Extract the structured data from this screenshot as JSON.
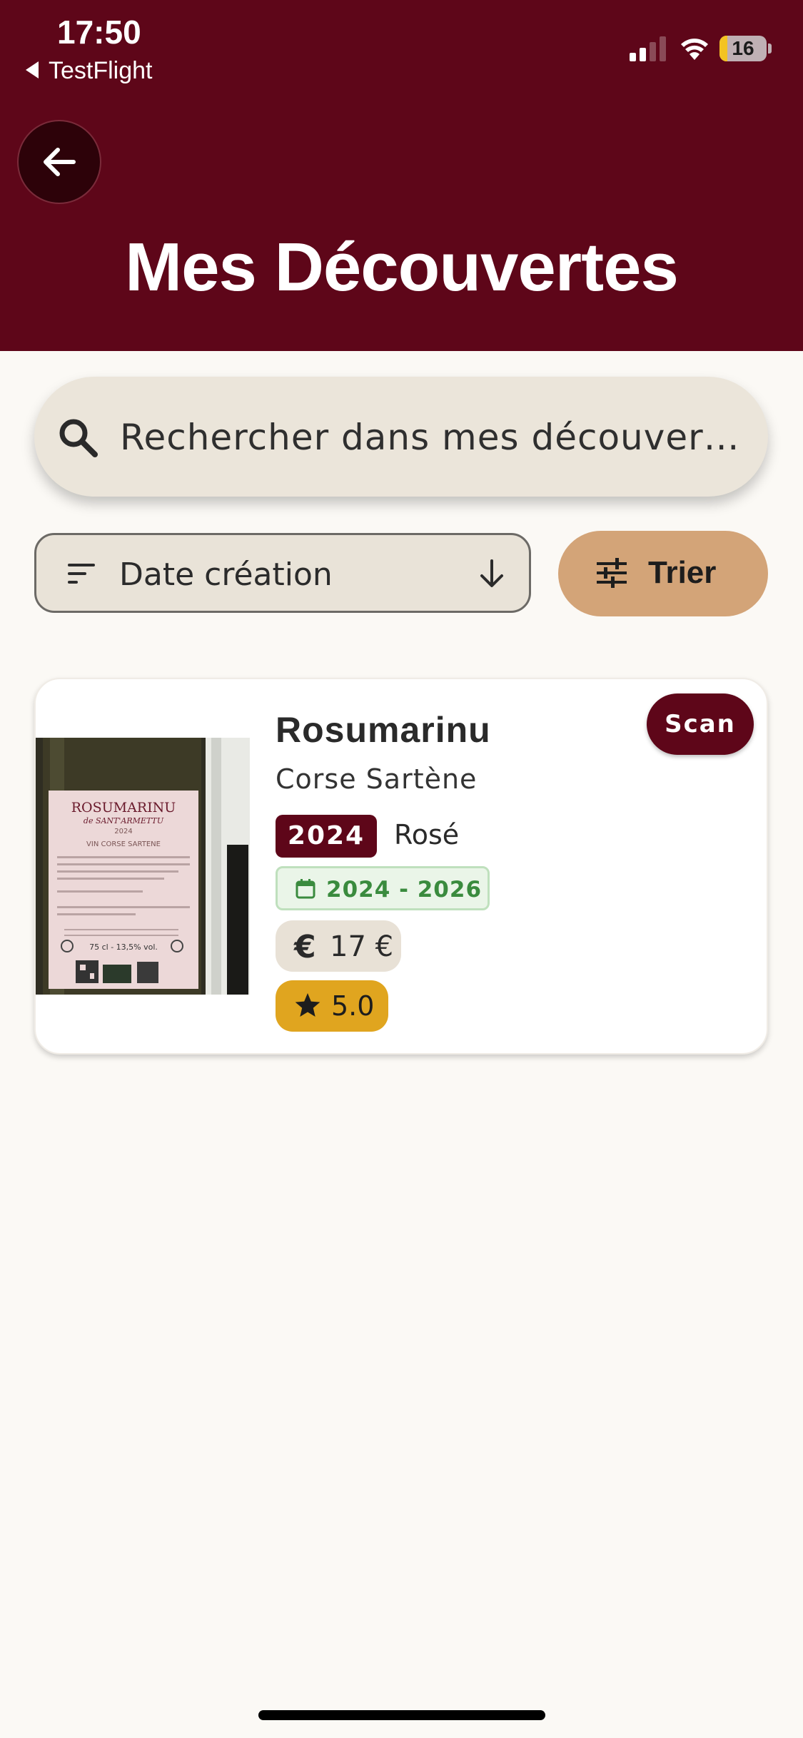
{
  "status_bar": {
    "time": "17:50",
    "back_app": "TestFlight",
    "battery_level": "16",
    "battery_fraction": 0.16
  },
  "header": {
    "title": "Mes Découvertes"
  },
  "search": {
    "placeholder": "Rechercher dans mes découvert…"
  },
  "sort": {
    "selected": "Date création",
    "button_label": "Trier"
  },
  "cards": [
    {
      "name": "Rosumarinu",
      "source_badge": "Scan",
      "region": "Corse Sartène",
      "year": "2024",
      "color": "Rosé",
      "drink_window": "2024 - 2026",
      "price": "17 €",
      "rating": "5.0",
      "label": {
        "brand": "ROSUMARINU",
        "producer": "de SANT'ARMETTU",
        "vintage": "2024",
        "appellation": "VIN CORSE SARTENE",
        "volume": "75 cl - 13,5% vol."
      }
    }
  ],
  "colors": {
    "header_bg": "#5e0619",
    "accent_tan": "#d3a478",
    "rating_gold": "#e0a51f",
    "window_green": "#3a8b3e"
  }
}
